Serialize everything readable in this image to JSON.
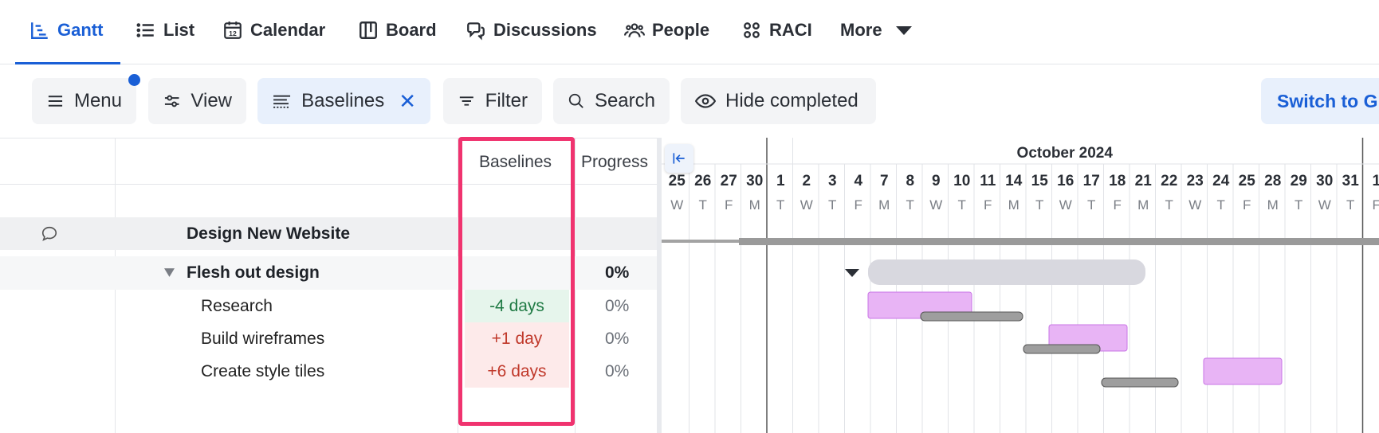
{
  "tabs": [
    {
      "label": "Gantt",
      "icon": "gantt-icon",
      "active": true
    },
    {
      "label": "List",
      "icon": "list-icon"
    },
    {
      "label": "Calendar",
      "icon": "calendar-icon"
    },
    {
      "label": "Board",
      "icon": "board-icon"
    },
    {
      "label": "Discussions",
      "icon": "discussions-icon"
    },
    {
      "label": "People",
      "icon": "people-icon"
    },
    {
      "label": "RACI",
      "icon": "raci-icon"
    },
    {
      "label": "More",
      "icon": "caret-down-icon"
    }
  ],
  "toolbar": {
    "menu": "Menu",
    "view": "View",
    "baselines": "Baselines",
    "filter": "Filter",
    "search": "Search",
    "hide_completed": "Hide completed",
    "switch": "Switch to G"
  },
  "columns": {
    "baselines": "Baselines",
    "progress": "Progress"
  },
  "project": {
    "name": "Design New Website"
  },
  "group": {
    "name": "Flesh out design",
    "progress": "0%"
  },
  "tasks": [
    {
      "name": "Research",
      "baseline": "-4 days",
      "progress": "0%"
    },
    {
      "name": "Build wireframes",
      "baseline": "+1 day",
      "progress": "0%"
    },
    {
      "name": "Create style tiles",
      "baseline": "+6 days",
      "progress": "0%"
    }
  ],
  "timeline": {
    "month": "October 2024",
    "days": [
      {
        "d": "25",
        "w": "W"
      },
      {
        "d": "26",
        "w": "T"
      },
      {
        "d": "27",
        "w": "F"
      },
      {
        "d": "30",
        "w": "M"
      },
      {
        "d": "1",
        "w": "T"
      },
      {
        "d": "2",
        "w": "W"
      },
      {
        "d": "3",
        "w": "T"
      },
      {
        "d": "4",
        "w": "F"
      },
      {
        "d": "7",
        "w": "M"
      },
      {
        "d": "8",
        "w": "T"
      },
      {
        "d": "9",
        "w": "W"
      },
      {
        "d": "10",
        "w": "T"
      },
      {
        "d": "11",
        "w": "F"
      },
      {
        "d": "14",
        "w": "M"
      },
      {
        "d": "15",
        "w": "T"
      },
      {
        "d": "16",
        "w": "W"
      },
      {
        "d": "17",
        "w": "T"
      },
      {
        "d": "18",
        "w": "F"
      },
      {
        "d": "21",
        "w": "M"
      },
      {
        "d": "22",
        "w": "T"
      },
      {
        "d": "23",
        "w": "W"
      },
      {
        "d": "24",
        "w": "T"
      },
      {
        "d": "25",
        "w": "F"
      },
      {
        "d": "28",
        "w": "M"
      },
      {
        "d": "29",
        "w": "T"
      },
      {
        "d": "30",
        "w": "W"
      },
      {
        "d": "31",
        "w": "T"
      },
      {
        "d": "1",
        "w": "F"
      }
    ]
  },
  "colors": {
    "accent": "#1a5fd6",
    "highlight": "#f0336f",
    "task_bar": "#e8b4f5",
    "baseline_bar": "#9e9e9e",
    "group_bar": "#d8d8df"
  }
}
